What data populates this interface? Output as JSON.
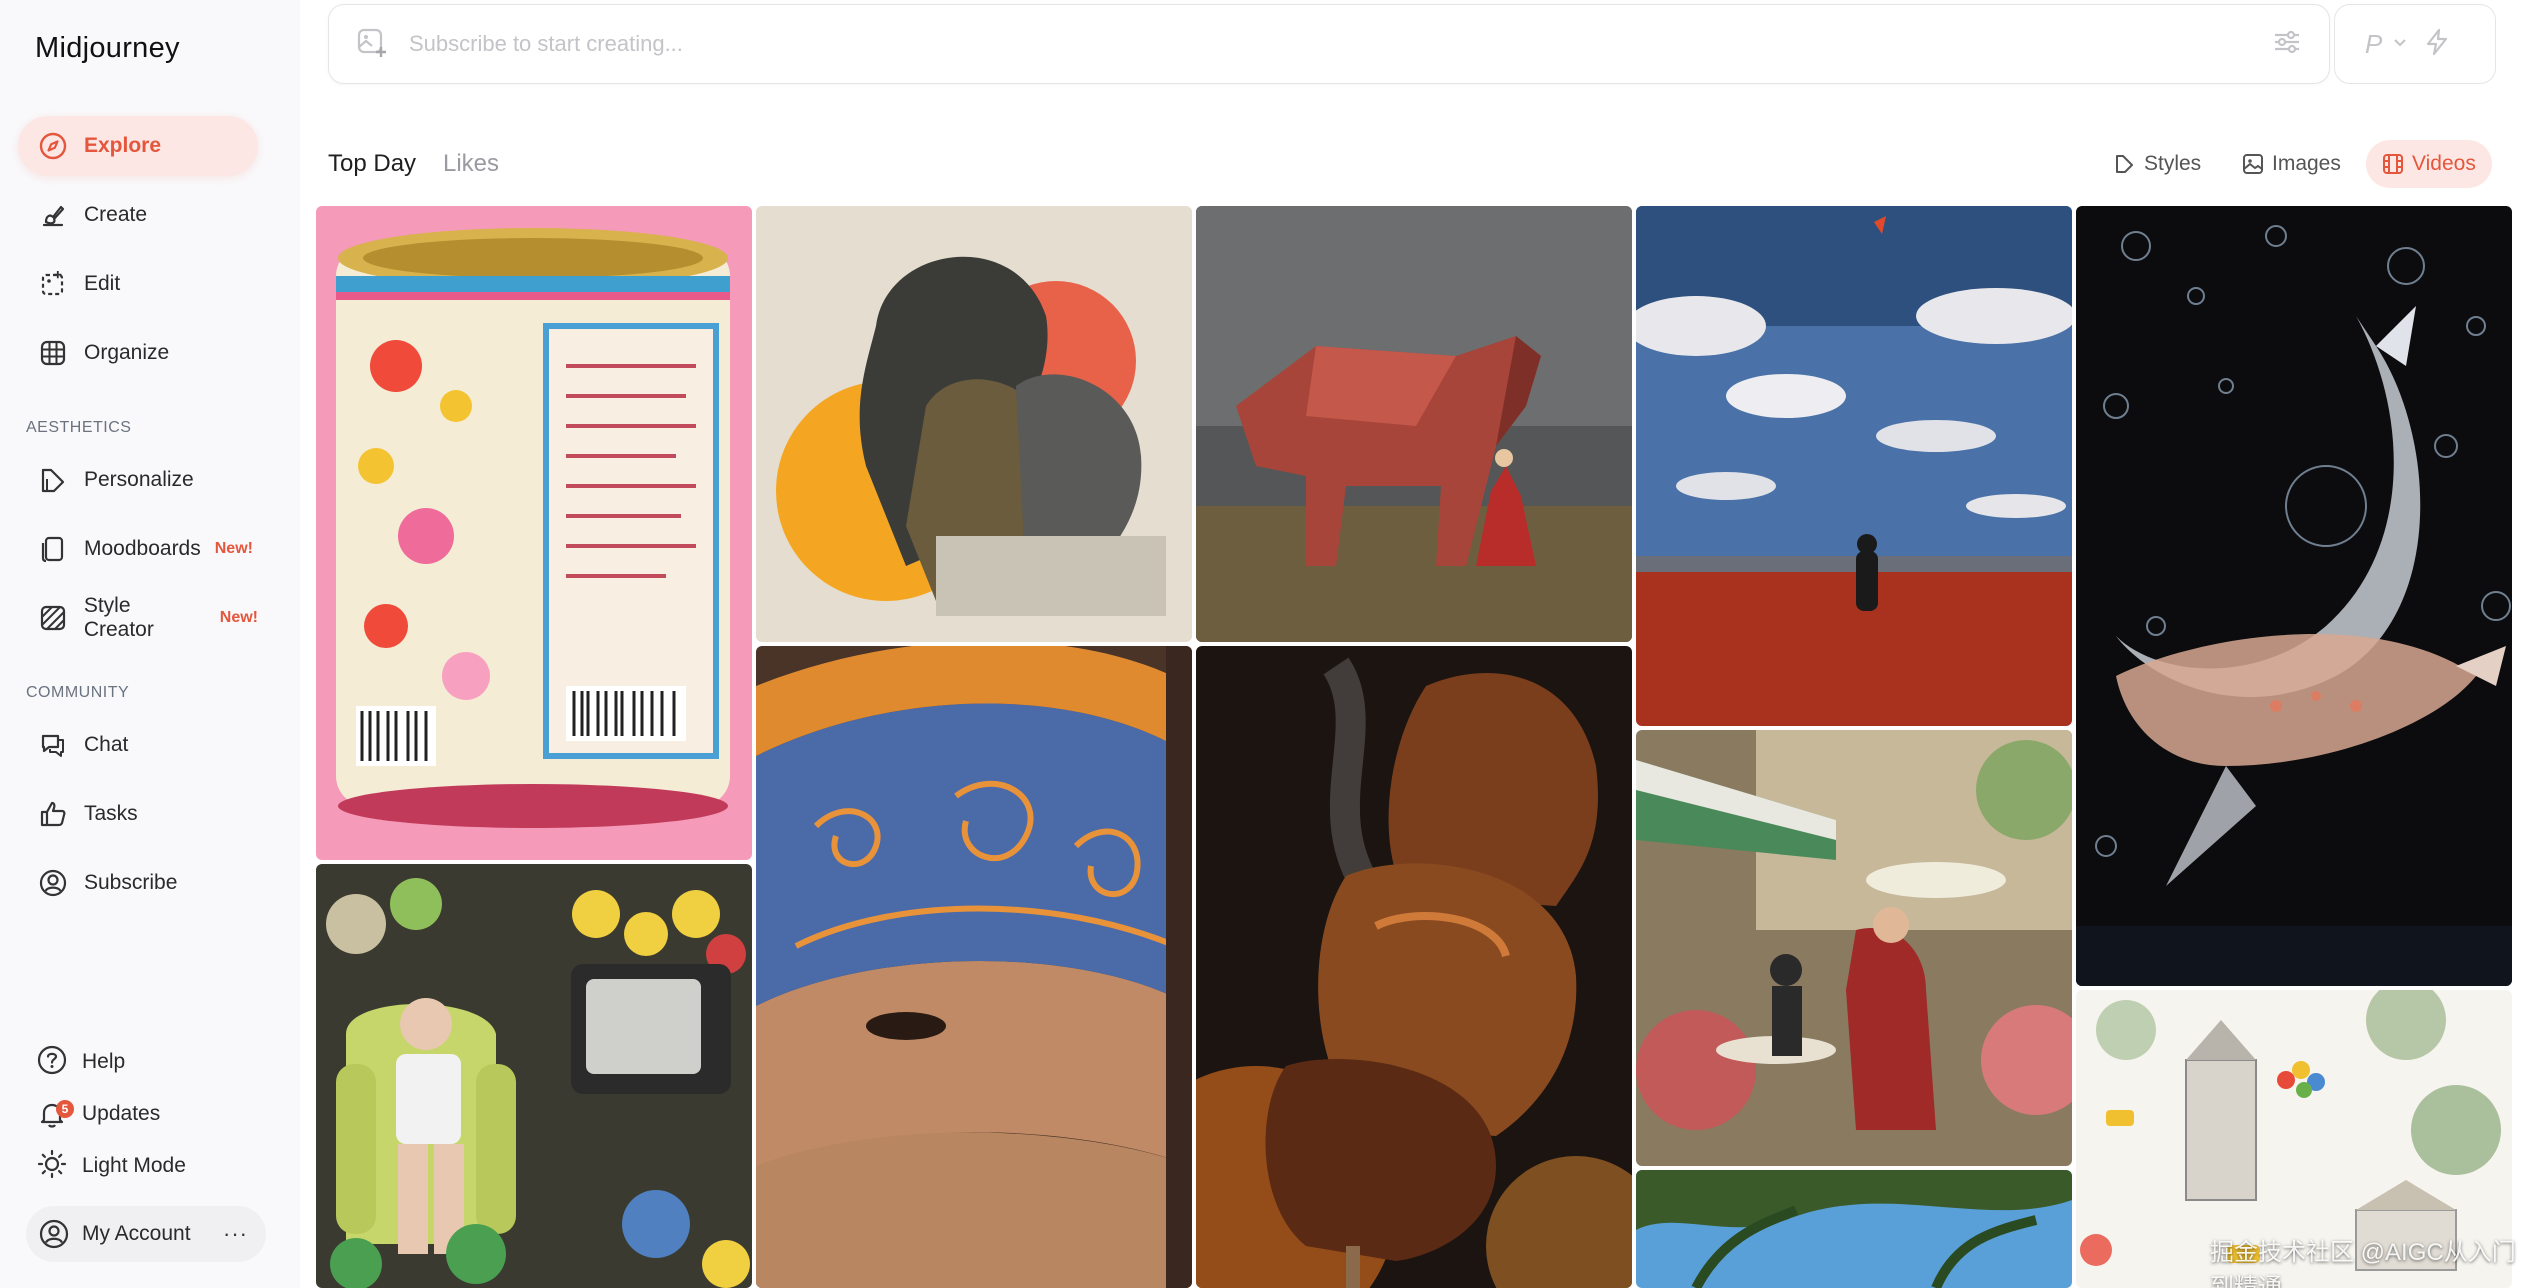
{
  "app": {
    "title": "Midjourney"
  },
  "nav": {
    "explore": "Explore",
    "create": "Create",
    "edit": "Edit",
    "organize": "Organize",
    "aesthetics_label": "AESTHETICS",
    "personalize": "Personalize",
    "moodboards": "Moodboards",
    "style_creator": "Style Creator",
    "new_badge": "New!",
    "community_label": "COMMUNITY",
    "chat": "Chat",
    "tasks": "Tasks",
    "subscribe": "Subscribe"
  },
  "bottom": {
    "help": "Help",
    "updates": "Updates",
    "updates_count": "5",
    "light_mode": "Light Mode",
    "account": "My Account",
    "more": "···"
  },
  "search": {
    "placeholder": "Subscribe to start creating...",
    "value": ""
  },
  "quick": {
    "profile_letter": "P"
  },
  "tabs": {
    "top_day": "Top Day",
    "likes": "Likes"
  },
  "filters": {
    "styles": "Styles",
    "images": "Images",
    "videos": "Videos"
  },
  "accent_color": "#e4573d",
  "grid_items": [
    "Floral tin can",
    "Layered portrait collage",
    "Origami bear with woman",
    "Man in red field",
    "Glass koi fish",
    "Man in armchair with toys",
    "Embroidered mask",
    "Grilled meat skewer",
    "Cafe terrace scene",
    "Watercolor town",
    "Palm trees"
  ],
  "watermark": "掘金技术社区 @AIGC从入门到精通"
}
